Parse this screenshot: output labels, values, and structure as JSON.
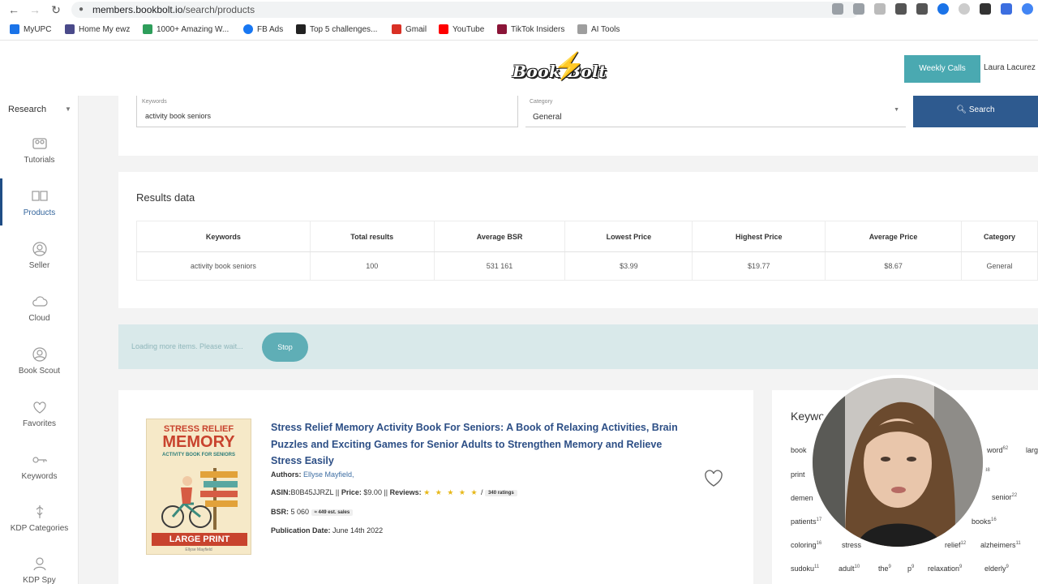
{
  "browser": {
    "url_domain": "members.bookbolt.io",
    "url_path": "/search/products",
    "bookmarks": [
      {
        "label": "MyUPC",
        "color": "#1a73e8"
      },
      {
        "label": "Home My ewz",
        "color": "#4a4a8a"
      },
      {
        "label": "1000+ Amazing W...",
        "color": "#2e9e5b"
      },
      {
        "label": "FB Ads",
        "color": "#1877f2"
      },
      {
        "label": "Top 5 challenges...",
        "color": "#222222"
      },
      {
        "label": "Gmail",
        "color": "#d93025"
      },
      {
        "label": "YouTube",
        "color": "#ff0000"
      },
      {
        "label": "TikTok Insiders",
        "color": "#8b1538"
      },
      {
        "label": "AI Tools",
        "color": "#9e9e9e"
      }
    ]
  },
  "header": {
    "logo_text": "Book Bolt",
    "weekly_calls": "Weekly Calls",
    "user_name": "Laura Lacurez"
  },
  "sidebar": {
    "section": "Research",
    "items": [
      {
        "label": "Tutorials",
        "icon": "tutorials-icon"
      },
      {
        "label": "Products",
        "icon": "book-open-icon"
      },
      {
        "label": "Seller",
        "icon": "seller-icon"
      },
      {
        "label": "Cloud",
        "icon": "cloud-icon"
      },
      {
        "label": "Book Scout",
        "icon": "book-scout-icon"
      },
      {
        "label": "Favorites",
        "icon": "heart-icon"
      },
      {
        "label": "Keywords",
        "icon": "key-icon"
      },
      {
        "label": "KDP Categories",
        "icon": "usb-icon"
      },
      {
        "label": "KDP Spy",
        "icon": "spy-icon"
      }
    ]
  },
  "search": {
    "keywords_label": "Keywords",
    "keywords_value": "activity book seniors",
    "category_label": "Category",
    "category_value": "General",
    "search_button": "Search"
  },
  "results": {
    "title": "Results data",
    "headers": [
      "Keywords",
      "Total results",
      "Average BSR",
      "Lowest Price",
      "Highest Price",
      "Average Price",
      "Category"
    ],
    "row": [
      "activity book seniors",
      "100",
      "531 161",
      "$3.99",
      "$19.77",
      "$8.67",
      "General"
    ]
  },
  "loading": {
    "text": "Loading more items. Please wait...",
    "stop": "Stop"
  },
  "product": {
    "cover_line1": "STRESS RELIEF",
    "cover_line2": "MEMORY",
    "cover_line3": "ACTIVITY BOOK FOR SENIORS",
    "cover_banner": "LARGE PRINT",
    "cover_author": "Ellyse Mayfield",
    "title": "Stress Relief Memory Activity Book For Seniors: A Book of Relaxing Activities, Brain Puzzles and Exciting Games for Senior Adults to Strengthen Memory and Relieve Stress Easily",
    "authors_label": "Authors:",
    "authors": "Ellyse Mayfield,",
    "asin_label": "ASIN:",
    "asin": "B0B45JJRZL",
    "price_label": "Price:",
    "price": "$9.00",
    "reviews_label": "Reviews:",
    "stars": "★ ★ ★ ★ ★",
    "ratings": "340 ratings",
    "bsr_label": "BSR:",
    "bsr": "5 060",
    "sales": "≈ 449 est. sales",
    "pub_label": "Publication Date:",
    "pub_date": "June 14th 2022"
  },
  "keywords_panel": {
    "title": "Keywords",
    "words": [
      {
        "w": "book",
        "n": ""
      },
      {
        "w": "word",
        "n": "62"
      },
      {
        "w": "large",
        "n": ""
      },
      {
        "w": "print",
        "n": ""
      },
      {
        "w": "",
        "n": "38"
      },
      {
        "w": "demen",
        "n": ""
      },
      {
        "w": "senior",
        "n": "22"
      },
      {
        "w": "patients",
        "n": "17"
      },
      {
        "w": "books",
        "n": "16"
      },
      {
        "w": "coloring",
        "n": "16"
      },
      {
        "w": "stress",
        "n": ""
      },
      {
        "w": "relief",
        "n": "12"
      },
      {
        "w": "alzheimers",
        "n": "11"
      },
      {
        "w": "sudoku",
        "n": "11"
      },
      {
        "w": "adult",
        "n": "10"
      },
      {
        "w": "the",
        "n": "9"
      },
      {
        "w": "p",
        "n": "9"
      },
      {
        "w": "relaxation",
        "n": "9"
      },
      {
        "w": "elderly",
        "n": "9"
      }
    ]
  },
  "colors": {
    "accent_teal": "#4aa9b1",
    "search_blue": "#2e5a8f",
    "title_blue": "#2d4f86"
  }
}
